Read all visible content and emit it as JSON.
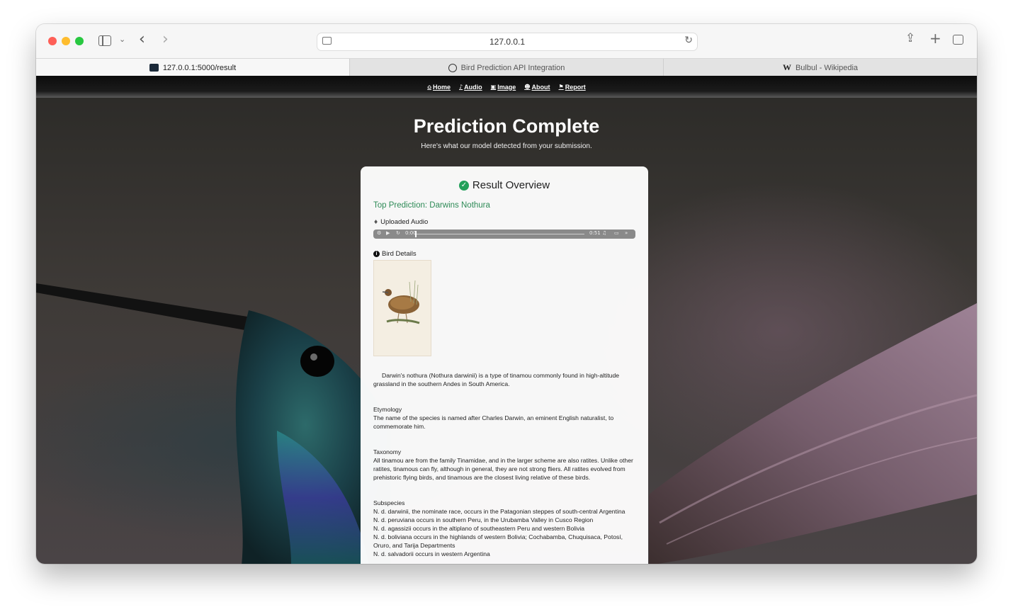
{
  "browser": {
    "url": "127.0.0.1",
    "tabs": [
      {
        "label": "127.0.0.1:5000/result",
        "active": true
      },
      {
        "label": "Bird Prediction API Integration",
        "active": false
      },
      {
        "label": "Bulbul - Wikipedia",
        "active": false
      }
    ]
  },
  "nav": {
    "items": [
      {
        "label": "Home",
        "icon": "home-icon"
      },
      {
        "label": "Audio",
        "icon": "microphone-icon"
      },
      {
        "label": "Image",
        "icon": "image-icon"
      },
      {
        "label": "About",
        "icon": "users-icon"
      },
      {
        "label": "Report",
        "icon": "flag-icon"
      }
    ]
  },
  "hero": {
    "title": "Prediction Complete",
    "subtitle": "Here's what our model detected from your submission."
  },
  "card": {
    "title": "Result Overview",
    "top_prediction": "Top Prediction: Darwins Nothura",
    "uploaded_audio_label": "Uploaded Audio",
    "audio": {
      "current": "0:00",
      "duration": "0:51"
    },
    "bird_details_label": "Bird Details",
    "intro": "Darwin's nothura (Nothura darwinii) is a type of tinamou commonly found in high-altitude grassland in the southern Andes in South America.",
    "etymology_heading": "Etymology",
    "etymology": "The name of the species is named after Charles Darwin, an eminent English naturalist, to commemorate him.",
    "taxonomy_heading": "Taxonomy",
    "taxonomy": "All tinamou are from the family Tinamidae, and in the larger scheme are also ratites. Unlike other ratites, tinamous can fly, although in general, they are not strong fliers. All ratites evolved from prehistoric flying birds, and tinamous are the closest living relative of these birds.",
    "subspecies_heading": "Subspecies",
    "subspecies": [
      "N. d. darwinii, the nominate race, occurs in the Patagonian steppes of south-central Argentina",
      "N. d. peruviana occurs in southern Peru, in the Urubamba Valley in Cusco Region",
      "N. d. agassizii occurs in the altiplano of southeastern Peru and western Bolivia",
      "N. d. boliviana occurs in the highlands of western Bolivia; Cochabamba, Chuquisaca, Potosí, Oruro, and Tarija Departments",
      "N. d. salvadorii occurs in western Argentina"
    ]
  }
}
